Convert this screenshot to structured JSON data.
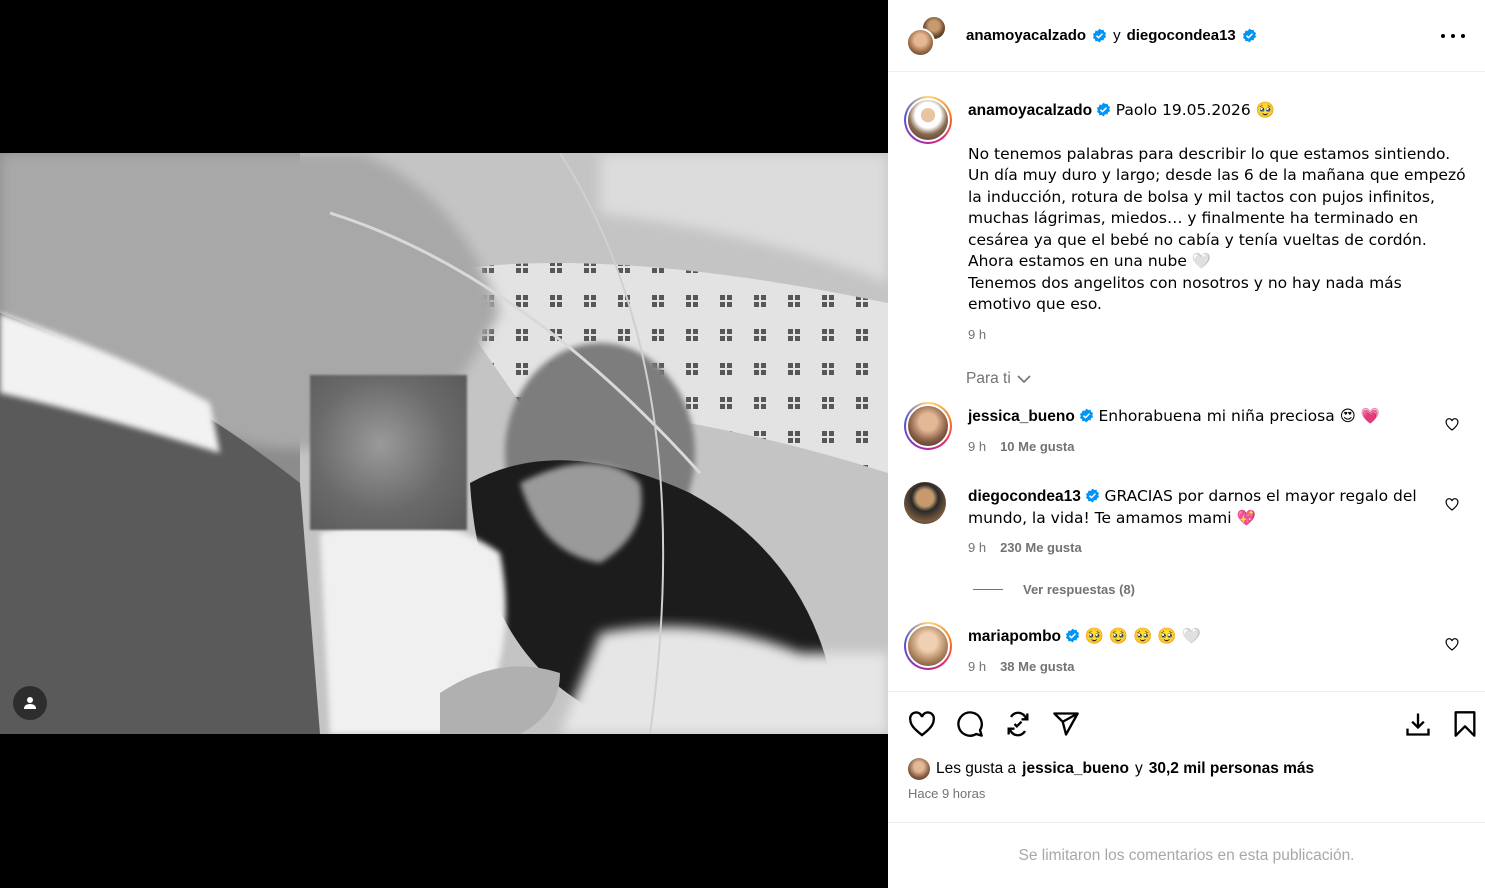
{
  "header": {
    "author1": "anamoyacalzado",
    "connector": "y",
    "author2": "diegocondea13"
  },
  "caption": {
    "username": "anamoyacalzado",
    "title_line": "Paolo 19.05.2026 🥹",
    "text": "No tenemos palabras para describir lo que estamos sintiendo.\nUn día muy duro y largo; desde las 6 de la mañana que empezó la inducción, rotura de bolsa y mil tactos con pujos infinitos, muchas lágrimas, miedos… y finalmente ha terminado en cesárea ya que el bebé no cabía y tenía vueltas de cordón.\nAhora estamos en una nube 🤍\nTenemos dos angelitos con nosotros y no hay nada más emotivo que eso.",
    "time": "9 h"
  },
  "filter_label": "Para ti",
  "comments": [
    {
      "username": "jessica_bueno",
      "verified": true,
      "text": "Enhorabuena mi niña preciosa 😍 💗",
      "time": "9 h",
      "likes": "10 Me gusta"
    },
    {
      "username": "diegocondea13",
      "verified": true,
      "text": "GRACIAS por darnos el mayor regalo del mundo, la vida! Te amamos mami 💖",
      "time": "9 h",
      "likes": "230 Me gusta"
    },
    {
      "username": "mariapombo",
      "verified": true,
      "text": "🥹 🥹 🥹 🥹 🤍",
      "time": "9 h",
      "likes": "38 Me gusta"
    }
  ],
  "replies_label": "Ver respuestas (8)",
  "likes": {
    "prefix": "Les gusta a",
    "user": "jessica_bueno",
    "connector": "y",
    "others": "30,2 mil personas más"
  },
  "posted_ago": "Hace 9 horas",
  "comments_limited": "Se limitaron los comentarios en esta publicación.",
  "icons": {
    "like": "heart-icon",
    "comment": "comment-icon",
    "share": "repost-icon",
    "send": "send-icon",
    "download": "download-icon",
    "save": "bookmark-icon"
  },
  "colors": {
    "verified": "#0095f6",
    "muted": "#737373",
    "border": "#efefef"
  }
}
